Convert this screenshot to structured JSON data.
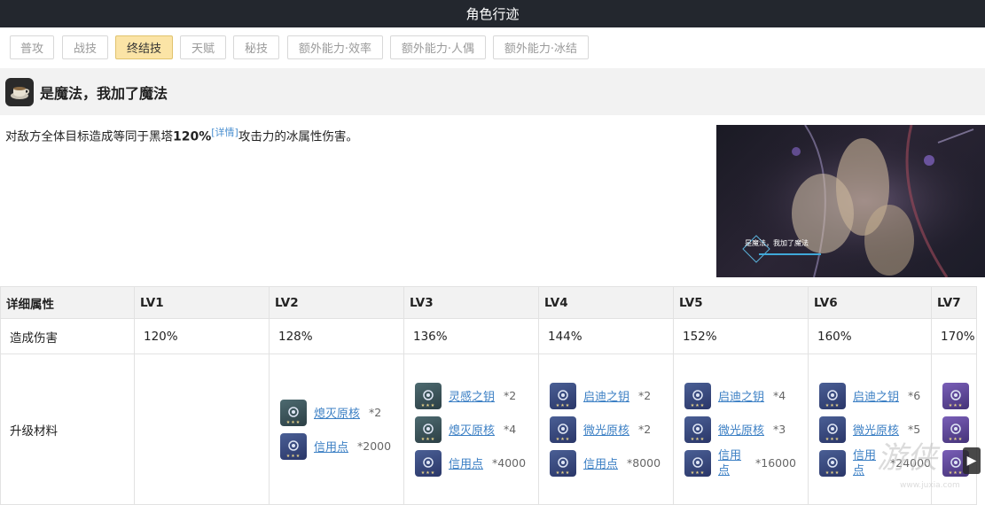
{
  "header": {
    "title": "角色行迹"
  },
  "tabs": [
    {
      "label": "普攻",
      "active": false
    },
    {
      "label": "战技",
      "active": false
    },
    {
      "label": "终结技",
      "active": true
    },
    {
      "label": "天赋",
      "active": false
    },
    {
      "label": "秘技",
      "active": false
    },
    {
      "label": "额外能力·效率",
      "active": false
    },
    {
      "label": "额外能力·人偶",
      "active": false
    },
    {
      "label": "额外能力·冰结",
      "active": false
    }
  ],
  "skill": {
    "name": "是魔法，我加了魔法",
    "icon": "teacup-icon",
    "description": {
      "prefix": "对敌方全体目标造成等同于黑塔",
      "value": "120%",
      "detail_link": "[详情]",
      "suffix": "攻击力的冰属性伤害。"
    },
    "artwork_caption": "是魔法，我加了魔法"
  },
  "table": {
    "header_label": "详细属性",
    "levels": [
      "LV1",
      "LV2",
      "LV3",
      "LV4",
      "LV5",
      "LV6",
      "LV7"
    ],
    "damage_label": "造成伤害",
    "damage_values": [
      "120%",
      "128%",
      "136%",
      "144%",
      "152%",
      "160%",
      "170%"
    ],
    "materials_label": "升级材料",
    "materials": [
      [],
      [
        {
          "name": "熄灭原核",
          "qty": "*2",
          "color": "teal"
        },
        {
          "name": "信用点",
          "qty": "*2000",
          "color": "blue"
        }
      ],
      [
        {
          "name": "灵感之钥",
          "qty": "*2",
          "color": "teal"
        },
        {
          "name": "熄灭原核",
          "qty": "*4",
          "color": "teal"
        },
        {
          "name": "信用点",
          "qty": "*4000",
          "color": "blue"
        }
      ],
      [
        {
          "name": "启迪之钥",
          "qty": "*2",
          "color": "blue"
        },
        {
          "name": "微光原核",
          "qty": "*2",
          "color": "blue"
        },
        {
          "name": "信用点",
          "qty": "*8000",
          "color": "blue"
        }
      ],
      [
        {
          "name": "启迪之钥",
          "qty": "*4",
          "color": "blue"
        },
        {
          "name": "微光原核",
          "qty": "*3",
          "color": "blue"
        },
        {
          "name": "信用点",
          "qty": "*16000",
          "color": "blue",
          "wrap": true
        }
      ],
      [
        {
          "name": "启迪之钥",
          "qty": "*6",
          "color": "blue"
        },
        {
          "name": "微光原核",
          "qty": "*5",
          "color": "blue"
        },
        {
          "name": "信用点",
          "qty": "*24000",
          "color": "blue",
          "wrap": true
        }
      ],
      [
        {
          "name": "",
          "qty": "",
          "color": "purple"
        },
        {
          "name": "",
          "qty": "",
          "color": "purple"
        },
        {
          "name": "",
          "qty": "",
          "color": "purple"
        }
      ]
    ]
  },
  "watermark": "游侠网 www.juxia.com",
  "colors": {
    "header_bg": "#23272e",
    "active_tab": "#fbe4a6",
    "link": "#3b7fc4"
  }
}
